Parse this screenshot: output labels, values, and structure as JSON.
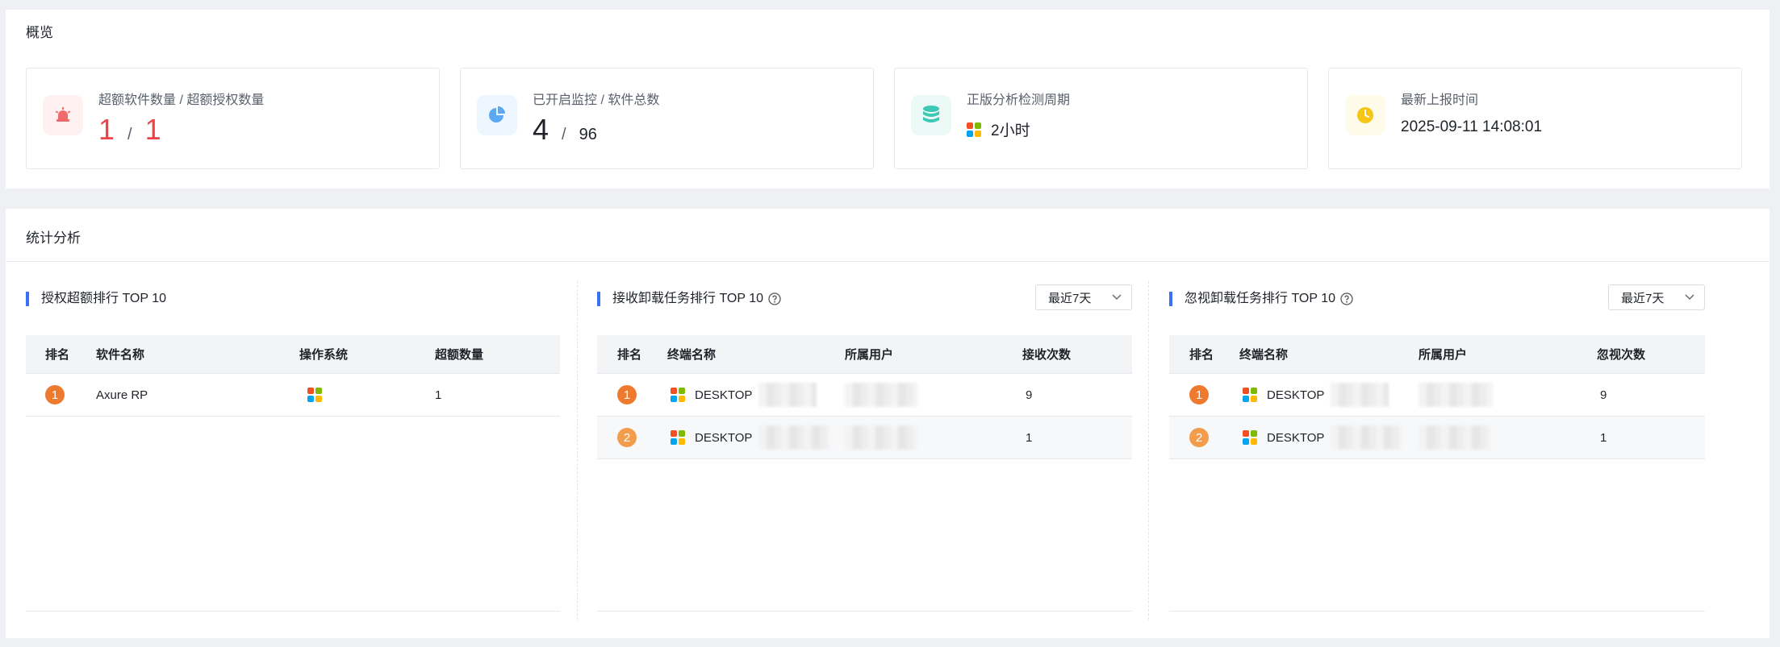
{
  "overview": {
    "title": "概览",
    "cards": [
      {
        "label": "超额软件数量 / 超额授权数量",
        "value_a": "1",
        "sep": "/",
        "value_b": "1",
        "icon": "alarm-icon",
        "color": "#f04345"
      },
      {
        "label": "已开启监控 / 软件总数",
        "value_a": "4",
        "sep": "/",
        "value_b": "96",
        "icon": "pie-chart-icon",
        "color": "#4aa0f0"
      },
      {
        "label": "正版分析检测周期",
        "value": "2小时",
        "icon": "database-icon",
        "color": "#3cc8b4"
      },
      {
        "label": "最新上报时间",
        "value": "2025-09-11 14:08:01",
        "icon": "clock-icon",
        "color": "#f5c518"
      }
    ]
  },
  "stats": {
    "title": "统计分析",
    "license_excess": {
      "title": "授权超额排行 TOP 10",
      "columns": [
        "排名",
        "软件名称",
        "操作系统",
        "超额数量"
      ],
      "rows": [
        {
          "rank": "1",
          "name": "Axure RP",
          "os": "windows-icon",
          "count": "1"
        }
      ]
    },
    "received_uninstall": {
      "title": "接收卸载任务排行 TOP 10",
      "range": "最近7天",
      "columns": [
        "排名",
        "终端名称",
        "所属用户",
        "接收次数"
      ],
      "rows": [
        {
          "rank": "1",
          "terminal": "DESKTOP",
          "count": "9"
        },
        {
          "rank": "2",
          "terminal": "DESKTOP",
          "count": "1"
        }
      ]
    },
    "ignored_uninstall": {
      "title": "忽视卸载任务排行 TOP 10",
      "range": "最近7天",
      "columns": [
        "排名",
        "终端名称",
        "所属用户",
        "忽视次数"
      ],
      "rows": [
        {
          "rank": "1",
          "terminal": "DESKTOP",
          "count": "9"
        },
        {
          "rank": "2",
          "terminal": "DESKTOP",
          "count": "1"
        }
      ]
    }
  }
}
